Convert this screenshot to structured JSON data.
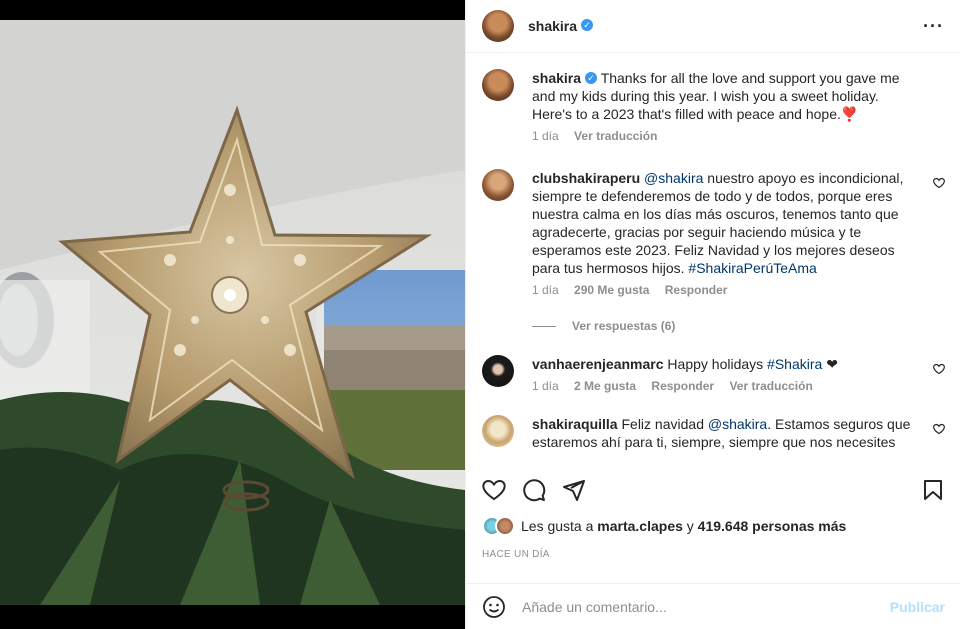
{
  "post": {
    "author": "shakira",
    "more_icon": "more-horizontal-icon"
  },
  "caption": {
    "author": "shakira",
    "text": "Thanks for all the love and support you gave me and my kids during this year. I wish you a sweet holiday. Here's to a 2023 that's filled with peace and hope.❣️",
    "time": "1 día",
    "translate": "Ver traducción"
  },
  "comments": [
    {
      "author": "clubshakiraperu",
      "mention": "@shakira",
      "text": " nuestro apoyo es incondicional, siempre te defenderemos de todo y de todos, porque eres nuestra calma en los días más oscuros, tenemos tanto que agradecerte, gracias por seguir haciendo música y te esperamos este 2023. Feliz Navidad y los mejores deseos para tus hermosos hijos. ",
      "hashtag": "#ShakiraPerúTeAma",
      "time": "1 día",
      "likes": "290 Me gusta",
      "reply": "Responder",
      "view_replies": "Ver respuestas (6)"
    },
    {
      "author": "vanhaerenjeanmarc",
      "text": "Happy holidays ",
      "hashtag": "#Shakira",
      "suffix": " ❤",
      "time": "1 día",
      "likes": "2 Me gusta",
      "reply": "Responder",
      "translate": "Ver traducción"
    },
    {
      "author": "shakiraquilla",
      "text": "Feliz navidad ",
      "mention": "@shakira",
      "text2": ". Estamos seguros que estaremos ahí para ti, siempre, siempre que nos necesites"
    }
  ],
  "likes": {
    "prefix": "Les gusta a ",
    "user": "marta.clapes",
    "middle": " y ",
    "count": "419.648 personas más"
  },
  "time_ago": "HACE UN DÍA",
  "add_comment": {
    "placeholder": "Añade un comentario...",
    "publish": "Publicar"
  },
  "colors": {
    "link": "#00376b",
    "verified": "#3897f0",
    "muted": "#8e8e8e",
    "publish_disabled": "#b2dffc"
  }
}
